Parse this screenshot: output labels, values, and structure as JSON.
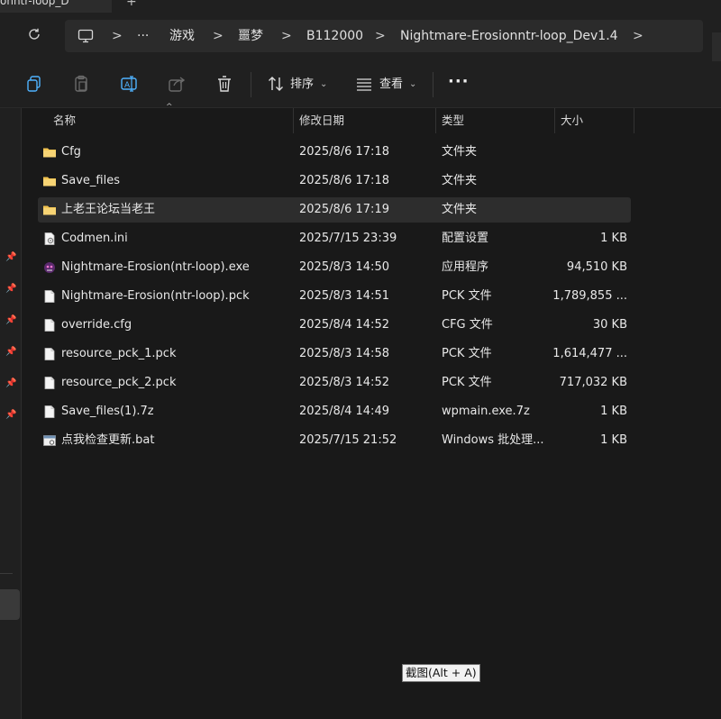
{
  "tab": {
    "title": "onntr-loop_D"
  },
  "address": {
    "crumbs": [
      "游戏",
      "噩梦",
      "B112000",
      "Nightmare-Erosionntr-loop_Dev1.4"
    ],
    "more_label": "···",
    "sep": ">"
  },
  "toolbar": {
    "sort_label": "排序",
    "view_label": "查看",
    "more_label": "···"
  },
  "columns": {
    "name": "名称",
    "date": "修改日期",
    "type": "类型",
    "size": "大小"
  },
  "files": [
    {
      "icon": "folder-icon",
      "name": "Cfg",
      "date": "2025/8/6 17:18",
      "type": "文件夹",
      "size": ""
    },
    {
      "icon": "folder-icon",
      "name": "Save_files",
      "date": "2025/8/6 17:18",
      "type": "文件夹",
      "size": ""
    },
    {
      "icon": "folder-icon",
      "name": "上老王论坛当老王",
      "date": "2025/8/6 17:19",
      "type": "文件夹",
      "size": ""
    },
    {
      "icon": "ini-file-icon",
      "name": "Codmen.ini",
      "date": "2025/7/15 23:39",
      "type": "配置设置",
      "size": "1 KB"
    },
    {
      "icon": "exe-app-icon",
      "name": "Nightmare-Erosion(ntr-loop).exe",
      "date": "2025/8/3 14:50",
      "type": "应用程序",
      "size": "94,510 KB"
    },
    {
      "icon": "file-icon",
      "name": "Nightmare-Erosion(ntr-loop).pck",
      "date": "2025/8/3 14:51",
      "type": "PCK 文件",
      "size": "1,789,855 ..."
    },
    {
      "icon": "file-icon",
      "name": "override.cfg",
      "date": "2025/8/4 14:52",
      "type": "CFG 文件",
      "size": "30 KB"
    },
    {
      "icon": "file-icon",
      "name": "resource_pck_1.pck",
      "date": "2025/8/3 14:58",
      "type": "PCK 文件",
      "size": "1,614,477 ..."
    },
    {
      "icon": "file-icon",
      "name": "resource_pck_2.pck",
      "date": "2025/8/3 14:52",
      "type": "PCK 文件",
      "size": "717,032 KB"
    },
    {
      "icon": "file-icon",
      "name": "Save_files(1).7z",
      "date": "2025/8/4 14:49",
      "type": "wpmain.exe.7z",
      "size": "1 KB"
    },
    {
      "icon": "bat-file-icon",
      "name": "点我检查更新.bat",
      "date": "2025/7/15 21:52",
      "type": "Windows 批处理...",
      "size": "1 KB"
    }
  ],
  "selected_index": 2,
  "tooltip": {
    "text": "截图(Alt + A)"
  },
  "colors": {
    "background": "#191919",
    "toolbar": "#202020",
    "folder": "#f2c451",
    "selected_row": "#2d2d2d"
  }
}
